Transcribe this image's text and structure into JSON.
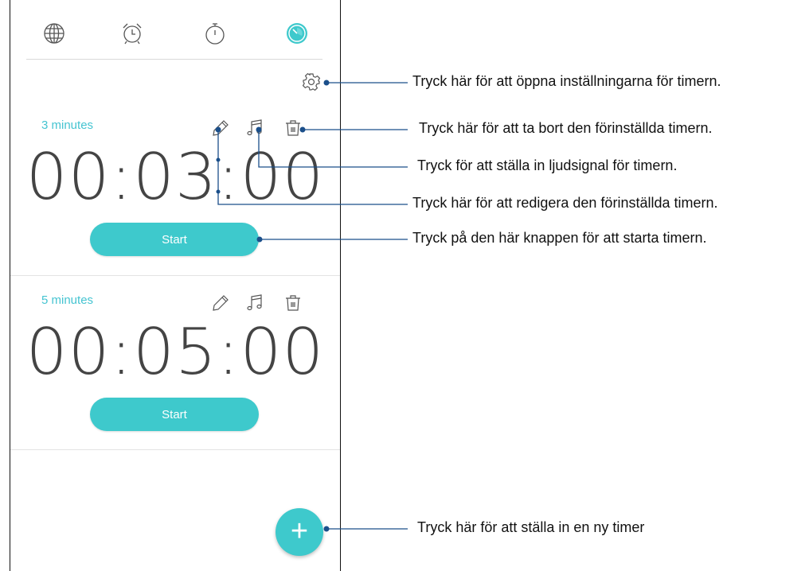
{
  "colors": {
    "accent": "#3ec9cc",
    "label": "#45c4d1",
    "icon": "#555555",
    "callout_line": "#1b4f8a"
  },
  "tabs": [
    {
      "name": "world-clock",
      "icon": "globe-icon"
    },
    {
      "name": "alarm",
      "icon": "alarm-clock-icon"
    },
    {
      "name": "stopwatch",
      "icon": "stopwatch-icon"
    },
    {
      "name": "timer",
      "icon": "timer-icon",
      "active": true
    }
  ],
  "timers": [
    {
      "label": "3 minutes",
      "time": "00:03:00",
      "start_label": "Start"
    },
    {
      "label": "5 minutes",
      "time": "00:05:00",
      "start_label": "Start"
    }
  ],
  "fab": {
    "label": "+"
  },
  "callouts": {
    "settings": "Tryck här för att öppna inställningarna för timern.",
    "delete": "Tryck här för att ta bort den förinställda timern.",
    "sound": "Tryck för att ställa in ljudsignal för timern.",
    "edit": "Tryck här för att redigera den förinställda timern.",
    "start": "Tryck på den här knappen för att starta timern.",
    "new_timer": "Tryck här för att ställa in en ny timer"
  }
}
